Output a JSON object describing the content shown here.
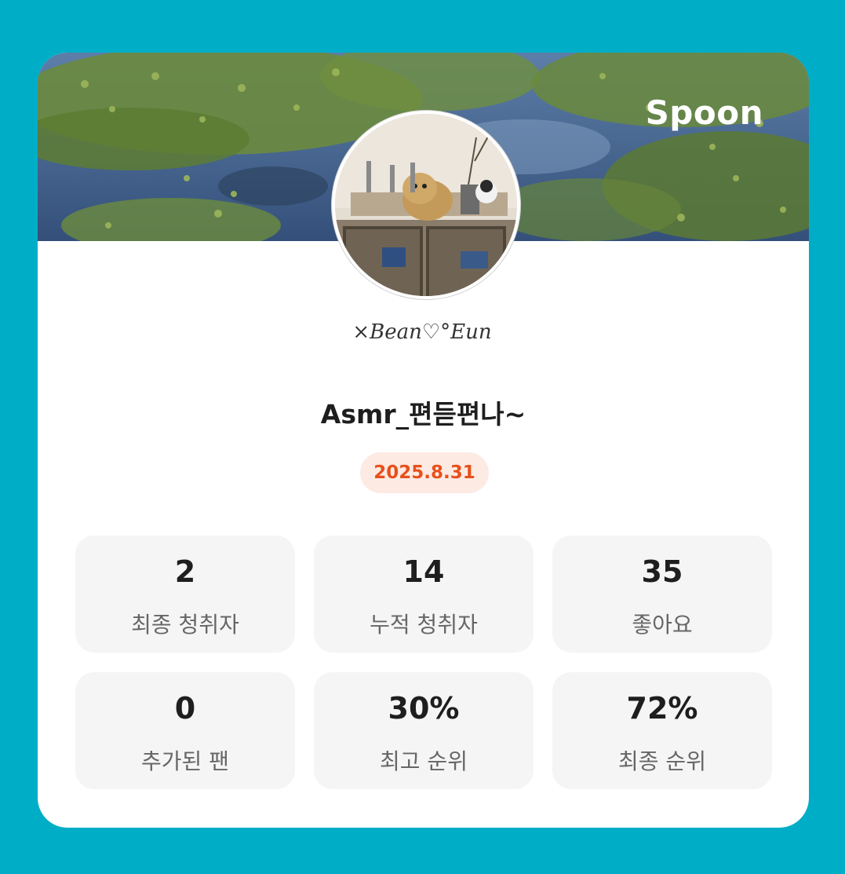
{
  "brand": {
    "name": "Spoon"
  },
  "profile": {
    "signature": "×Bean♡°Eun",
    "title": "Asmr_편듣편나~",
    "date": "2025.8.31"
  },
  "stats": [
    {
      "value": "2",
      "label": "최종 청취자"
    },
    {
      "value": "14",
      "label": "누적 청취자"
    },
    {
      "value": "35",
      "label": "좋아요"
    },
    {
      "value": "0",
      "label": "추가된 팬"
    },
    {
      "value": "30%",
      "label": "최고 순위"
    },
    {
      "value": "72%",
      "label": "최종 순위"
    }
  ],
  "colors": {
    "background": "#00adc7",
    "card": "#ffffff",
    "date_badge_bg": "#fdeae3",
    "date_badge_text": "#e8501c",
    "stat_tile": "#f5f5f5"
  }
}
